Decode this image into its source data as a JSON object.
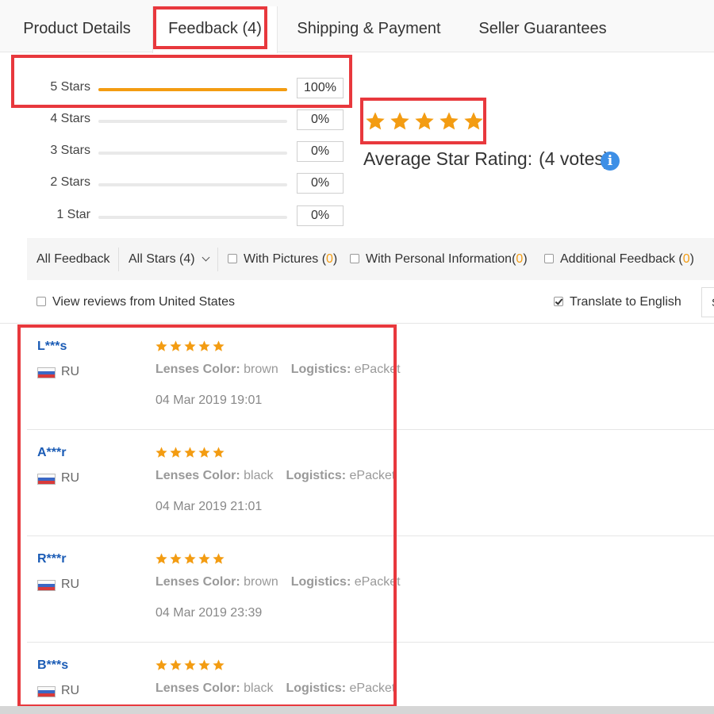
{
  "tabs": [
    {
      "label": "Product Details"
    },
    {
      "label": "Feedback (4)"
    },
    {
      "label": "Shipping & Payment"
    },
    {
      "label": "Seller Guarantees"
    }
  ],
  "ratings": [
    {
      "label": "5 Stars",
      "percent": "100%",
      "fill": 1.0
    },
    {
      "label": "4 Stars",
      "percent": "0%",
      "fill": 0
    },
    {
      "label": "3 Stars",
      "percent": "0%",
      "fill": 0
    },
    {
      "label": "2 Stars",
      "percent": "0%",
      "fill": 0
    },
    {
      "label": "1 Star",
      "percent": "0%",
      "fill": 0
    }
  ],
  "average": {
    "stars": 5,
    "label": "Average Star Rating:",
    "votes": "(4 votes)",
    "info_icon": "i"
  },
  "filters": {
    "all_feedback": "All Feedback",
    "all_stars": "All Stars (4)",
    "with_pictures": "With Pictures (",
    "with_pictures_count": "0",
    "with_personal": "With Personal Information(",
    "with_personal_count": "0",
    "additional": "Additional Feedback (",
    "additional_count": "0",
    "close_paren": ")",
    "view_us": "View reviews from United States",
    "translate": "Translate to English",
    "sort_stub": "S"
  },
  "reviews": [
    {
      "name": "L***s",
      "country": "RU",
      "attr1_label": "Lenses Color:",
      "attr1_value": "brown",
      "attr2_label": "Logistics:",
      "attr2_value": "ePacket",
      "date": "04 Mar 2019 19:01",
      "stars": 5
    },
    {
      "name": "A***r",
      "country": "RU",
      "attr1_label": "Lenses Color:",
      "attr1_value": "black",
      "attr2_label": "Logistics:",
      "attr2_value": "ePacket",
      "date": "04 Mar 2019 21:01",
      "stars": 5
    },
    {
      "name": "R***r",
      "country": "RU",
      "attr1_label": "Lenses Color:",
      "attr1_value": "brown",
      "attr2_label": "Logistics:",
      "attr2_value": "ePacket",
      "date": "04 Mar 2019 23:39",
      "stars": 5
    },
    {
      "name": "B***s",
      "country": "RU",
      "attr1_label": "Lenses Color:",
      "attr1_value": "black",
      "attr2_label": "Logistics:",
      "attr2_value": "ePacket",
      "stars": 5
    }
  ],
  "colors": {
    "accent": "#f39c12",
    "link": "#1a5bb5",
    "annotation": "#e8383d",
    "info": "#3d8fe6"
  }
}
